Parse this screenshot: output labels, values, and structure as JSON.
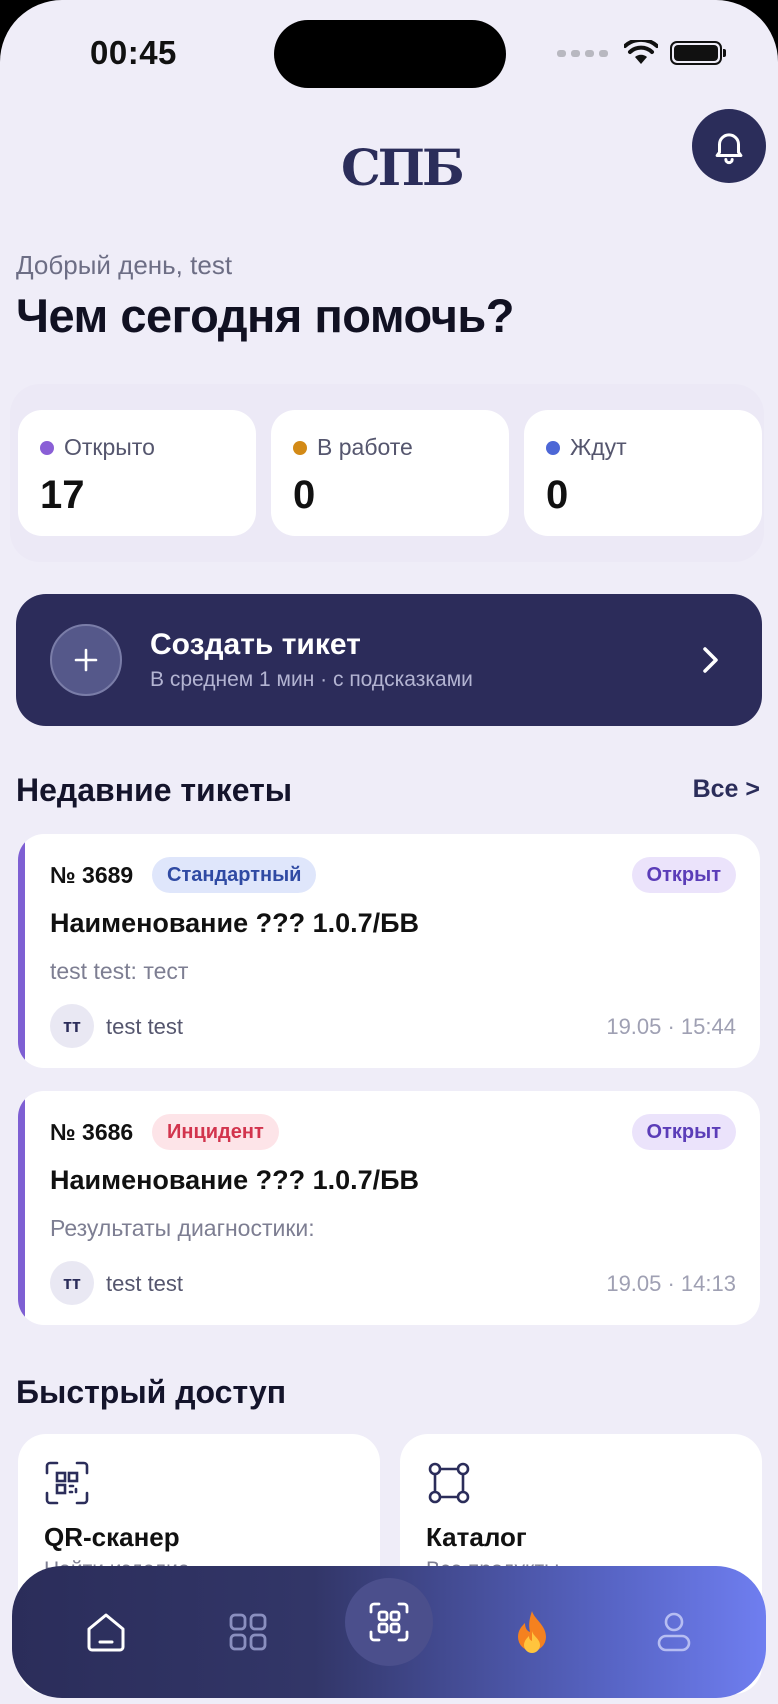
{
  "status_bar": {
    "time": "00:45"
  },
  "header": {
    "logo_text": "СПБ"
  },
  "greeting": "Добрый день, test",
  "headline": "Чем сегодня помочь?",
  "stats": [
    {
      "label": "Открыто",
      "value": "17",
      "color": "#8a5fd6"
    },
    {
      "label": "В работе",
      "value": "0",
      "color": "#d38a16"
    },
    {
      "label": "Ждут",
      "value": "0",
      "color": "#4d67d6"
    }
  ],
  "create_ticket": {
    "title": "Создать тикет",
    "subtitle": "В среднем 1 мин · с подсказками"
  },
  "recent": {
    "title": "Недавние тикеты",
    "all_link": "Все >",
    "tickets": [
      {
        "number": "№ 3689",
        "type": "Стандартный",
        "status": "Открыт",
        "name": "Наименование ??? 1.0.7/БВ",
        "description": "test test: тест",
        "initials": "тт",
        "author": "test test",
        "time": "19.05 · 15:44"
      },
      {
        "number": "№ 3686",
        "type": "Инцидент",
        "status": "Открыт",
        "name": "Наименование ??? 1.0.7/БВ",
        "description": "Результаты диагностики:",
        "initials": "тт",
        "author": "test test",
        "time": "19.05 · 14:13"
      }
    ]
  },
  "quick_access": {
    "title": "Быстрый доступ",
    "items": [
      {
        "title": "QR-сканер",
        "subtitle": "Найти изделие",
        "icon": "qr-icon"
      },
      {
        "title": "Каталог",
        "subtitle": "Все продукты",
        "icon": "catalog-icon"
      }
    ]
  },
  "tab_bar": {
    "items": [
      "home-icon",
      "grid-icon",
      "scan-icon",
      "fire-icon",
      "profile-icon"
    ]
  }
}
